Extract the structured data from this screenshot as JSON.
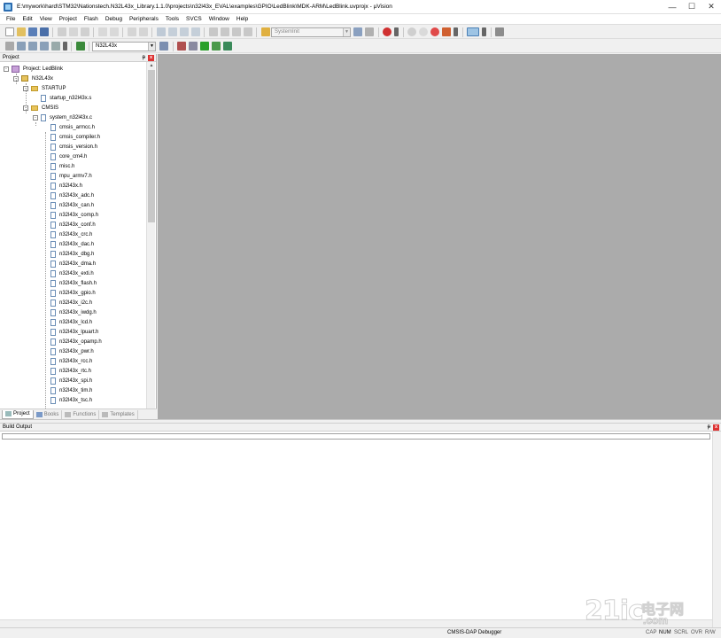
{
  "window": {
    "title": "E:\\mywork\\hard\\STM32\\Nationstech.N32L43x_Library.1.1.0\\projects\\n32l43x_EVAL\\examples\\GPIO\\LedBlink\\MDK-ARM\\LedBlink.uvprojx - µVision",
    "controls": {
      "minimize": "—",
      "maximize": "☐",
      "close": "✕"
    }
  },
  "menu": [
    "File",
    "Edit",
    "View",
    "Project",
    "Flash",
    "Debug",
    "Peripherals",
    "Tools",
    "SVCS",
    "Window",
    "Help"
  ],
  "toolbar": {
    "find_combo": "SystemInit",
    "target_combo": "N32L43x"
  },
  "project_panel": {
    "title": "Project",
    "pin_glyph": "ᵽ",
    "close_glyph": "x",
    "tree": [
      {
        "label": "Project: LedBlink",
        "kind": "project",
        "expander": "-"
      },
      {
        "label": "N32L43x",
        "kind": "target",
        "expander": "-"
      },
      {
        "label": "STARTUP",
        "kind": "folder",
        "expander": "-"
      },
      {
        "label": "startup_n32l43x.s",
        "kind": "file",
        "expander": ""
      },
      {
        "label": "CMSIS",
        "kind": "folder",
        "expander": "-"
      },
      {
        "label": "system_n32l43x.c",
        "kind": "file",
        "expander": "-"
      },
      {
        "label": "cmsis_armcc.h",
        "kind": "file",
        "expander": ""
      },
      {
        "label": "cmsis_compiler.h",
        "kind": "file",
        "expander": ""
      },
      {
        "label": "cmsis_version.h",
        "kind": "file",
        "expander": ""
      },
      {
        "label": "core_cm4.h",
        "kind": "file",
        "expander": ""
      },
      {
        "label": "misc.h",
        "kind": "file",
        "expander": ""
      },
      {
        "label": "mpu_armv7.h",
        "kind": "file",
        "expander": ""
      },
      {
        "label": "n32l43x.h",
        "kind": "file",
        "expander": ""
      },
      {
        "label": "n32l43x_adc.h",
        "kind": "file",
        "expander": ""
      },
      {
        "label": "n32l43x_can.h",
        "kind": "file",
        "expander": ""
      },
      {
        "label": "n32l43x_comp.h",
        "kind": "file",
        "expander": ""
      },
      {
        "label": "n32l43x_conf.h",
        "kind": "file",
        "expander": ""
      },
      {
        "label": "n32l43x_crc.h",
        "kind": "file",
        "expander": ""
      },
      {
        "label": "n32l43x_dac.h",
        "kind": "file",
        "expander": ""
      },
      {
        "label": "n32l43x_dbg.h",
        "kind": "file",
        "expander": ""
      },
      {
        "label": "n32l43x_dma.h",
        "kind": "file",
        "expander": ""
      },
      {
        "label": "n32l43x_exti.h",
        "kind": "file",
        "expander": ""
      },
      {
        "label": "n32l43x_flash.h",
        "kind": "file",
        "expander": ""
      },
      {
        "label": "n32l43x_gpio.h",
        "kind": "file",
        "expander": ""
      },
      {
        "label": "n32l43x_i2c.h",
        "kind": "file",
        "expander": ""
      },
      {
        "label": "n32l43x_iwdg.h",
        "kind": "file",
        "expander": ""
      },
      {
        "label": "n32l43x_lcd.h",
        "kind": "file",
        "expander": ""
      },
      {
        "label": "n32l43x_lpuart.h",
        "kind": "file",
        "expander": ""
      },
      {
        "label": "n32l43x_opamp.h",
        "kind": "file",
        "expander": ""
      },
      {
        "label": "n32l43x_pwr.h",
        "kind": "file",
        "expander": ""
      },
      {
        "label": "n32l43x_rcc.h",
        "kind": "file",
        "expander": ""
      },
      {
        "label": "n32l43x_rtc.h",
        "kind": "file",
        "expander": ""
      },
      {
        "label": "n32l43x_spi.h",
        "kind": "file",
        "expander": ""
      },
      {
        "label": "n32l43x_tim.h",
        "kind": "file",
        "expander": ""
      },
      {
        "label": "n32l43x_tsc.h",
        "kind": "file",
        "expander": ""
      }
    ],
    "tabs": [
      {
        "label": "Project",
        "active": true
      },
      {
        "label": "Books",
        "active": false
      },
      {
        "label": "Functions",
        "active": false
      },
      {
        "label": "Templates",
        "active": false
      }
    ]
  },
  "build_output": {
    "title": "Build Output",
    "pin_glyph": "ᵽ",
    "close_glyph": "x"
  },
  "statusbar": {
    "debugger": "CMSIS-DAP Debugger",
    "indicators": [
      "CAP",
      "NUM",
      "SCRL",
      "OVR",
      "R/W"
    ]
  },
  "watermark": {
    "logo": "21ic",
    "cn": "电子网",
    "domain": ".com"
  },
  "colors": {
    "editor_bg": "#ababab",
    "close_red": "#dd3333",
    "folder": "#e8c45a"
  }
}
